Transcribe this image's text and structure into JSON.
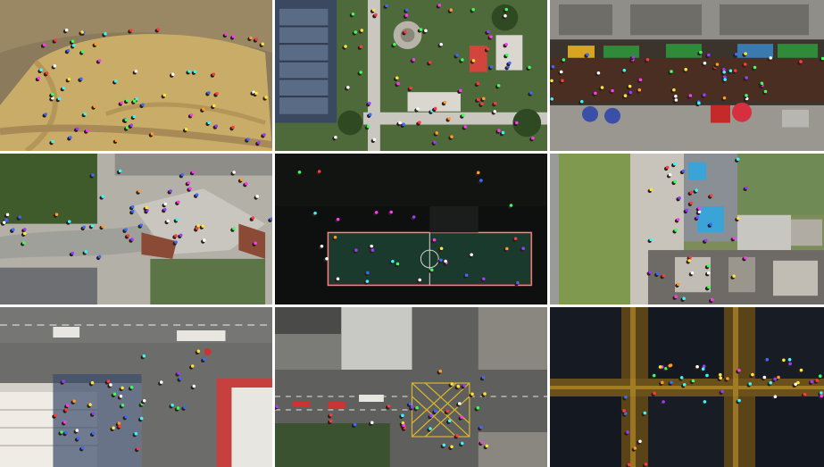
{
  "mosaic": {
    "rows": 3,
    "cols": 3,
    "tiles": [
      {
        "scene": "plaza-dance-group",
        "time": "day"
      },
      {
        "scene": "park-with-paths-and-tower",
        "time": "day"
      },
      {
        "scene": "market-stalls-with-umbrellas",
        "time": "day"
      },
      {
        "scene": "square-near-pond",
        "time": "day"
      },
      {
        "scene": "night-sports-court",
        "time": "night"
      },
      {
        "scene": "rooftops-and-lawn",
        "time": "day"
      },
      {
        "scene": "road-junction-with-buses",
        "time": "day"
      },
      {
        "scene": "crossroads-yellow-box-junction",
        "time": "day"
      },
      {
        "scene": "night-city-intersection",
        "time": "night"
      }
    ]
  },
  "marker_colors": [
    "#ff3b3b",
    "#3bff5a",
    "#3b6bff",
    "#ffe53b",
    "#ff3bf2",
    "#3bf7ff",
    "#ff9a2b",
    "#ffffff",
    "#9b3bff"
  ]
}
